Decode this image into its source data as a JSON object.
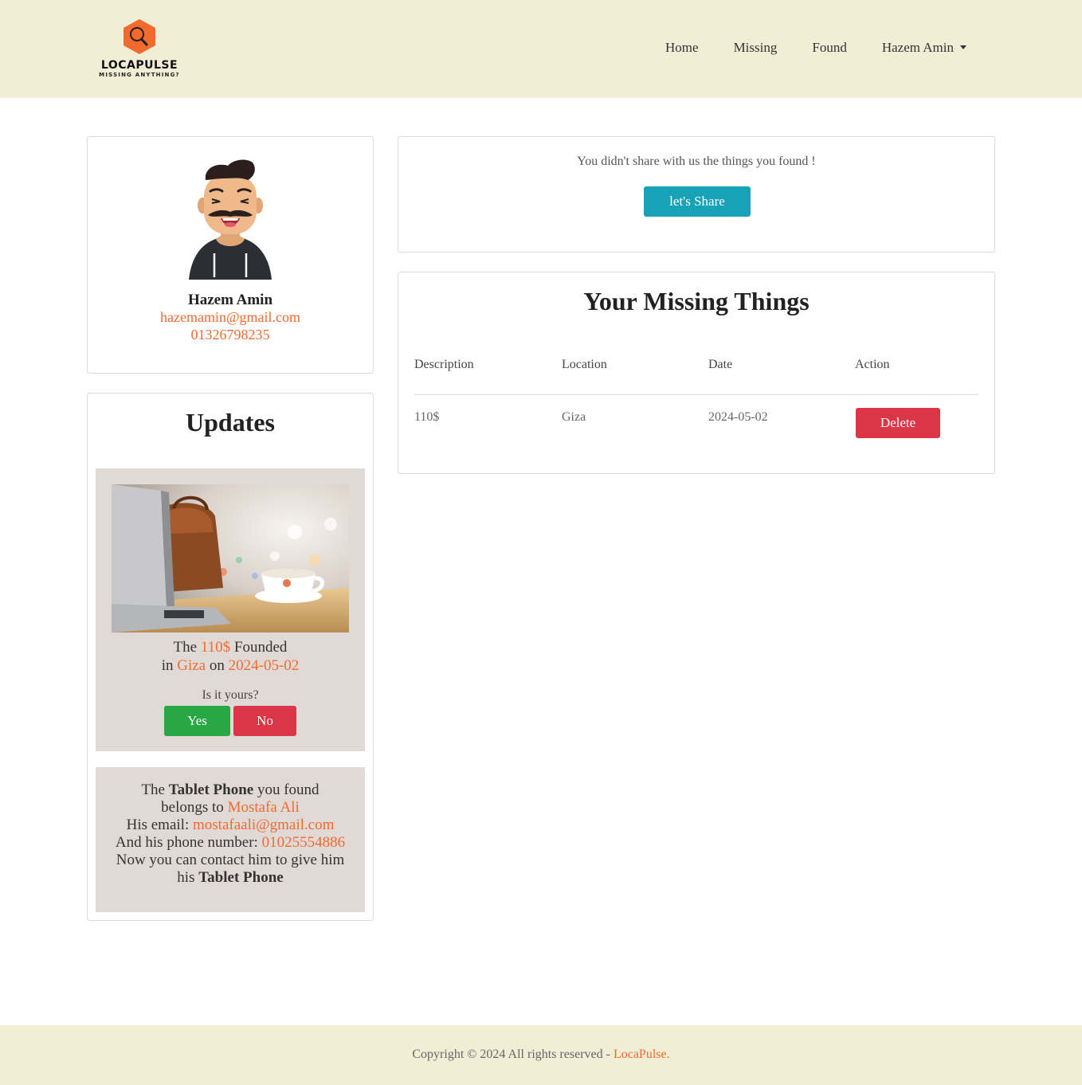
{
  "nav": {
    "logo_title": "LOCAPULSE",
    "logo_subtitle": "MISSING ANYTHING?",
    "links": [
      "Home",
      "Missing",
      "Found"
    ],
    "user": "Hazem Amin"
  },
  "profile": {
    "name": "Hazem Amin",
    "email": "hazemamin@gmail.com",
    "phone": "01326798235"
  },
  "updates": {
    "title": "Updates",
    "found_item": {
      "prefix": "The",
      "item": "110$",
      "verb": "Founded",
      "in_word": "in",
      "location": "Giza",
      "on_word": "on",
      "date": "2024-05-02",
      "question": "Is it yours?",
      "yes_label": "Yes",
      "no_label": "No"
    },
    "owner_notice": {
      "the_word": "The",
      "item": "Tablet Phone",
      "found_text": "you found",
      "belongs_text": "belongs to",
      "owner": "Mostafa Ali",
      "email_label": "His email:",
      "email": "mostafaali@gmail.com",
      "phone_label": "And his phone number:",
      "phone": "01025554886",
      "contact_text": "Now you can contact him to give him",
      "his_word": "his",
      "item_end": "Tablet Phone"
    }
  },
  "share": {
    "message": "You didn't share with us the things you found !",
    "button": "let's Share"
  },
  "missing": {
    "title": "Your Missing Things",
    "headers": [
      "Description",
      "Location",
      "Date",
      "Action"
    ],
    "rows": [
      {
        "description": "110$",
        "location": "Giza",
        "date": "2024-05-02",
        "action": "Delete"
      }
    ]
  },
  "footer": {
    "text": "Copyright © 2024 All rights reserved - ",
    "brand": "LocaPulse."
  },
  "colors": {
    "header_bg": "#f1eed6",
    "accent": "#f26a2e",
    "success": "#28a745",
    "danger": "#dc3545",
    "info": "#17a2b8",
    "update_bg": "#e0d9d6"
  }
}
